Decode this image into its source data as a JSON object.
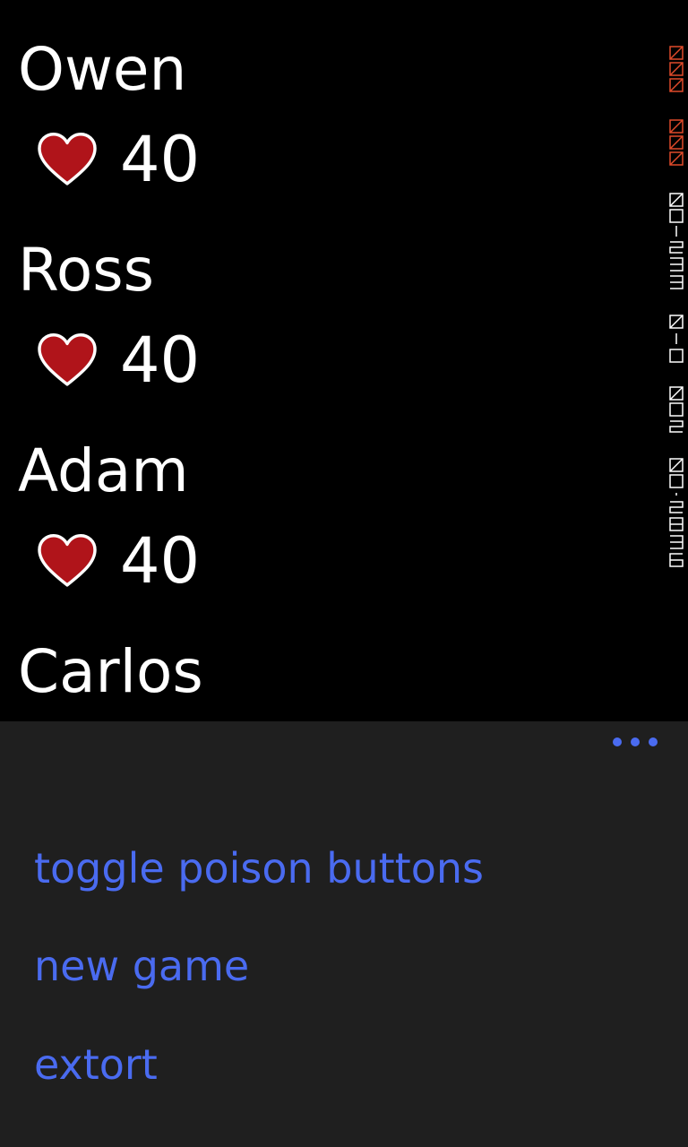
{
  "players": [
    {
      "name": "Owen",
      "life": "40",
      "life_icon": "heart-icon"
    },
    {
      "name": "Ross",
      "life": "40",
      "life_icon": "heart-icon"
    },
    {
      "name": "Adam",
      "life": "40",
      "life_icon": "heart-icon"
    },
    {
      "name": "Carlos"
    }
  ],
  "app_bar": {
    "more_icon": "ellipsis-icon",
    "menu_items": [
      {
        "label": "toggle poison buttons"
      },
      {
        "label": "new game"
      },
      {
        "label": "extort"
      }
    ]
  },
  "colors": {
    "background": "#000000",
    "app_bar_background": "#1f1f1f",
    "accent": "#4a6bf0",
    "heart_fill": "#b0141a",
    "heart_outline": "#ffffff",
    "text": "#ffffff",
    "debug_counter_red": "#e04a2a"
  }
}
